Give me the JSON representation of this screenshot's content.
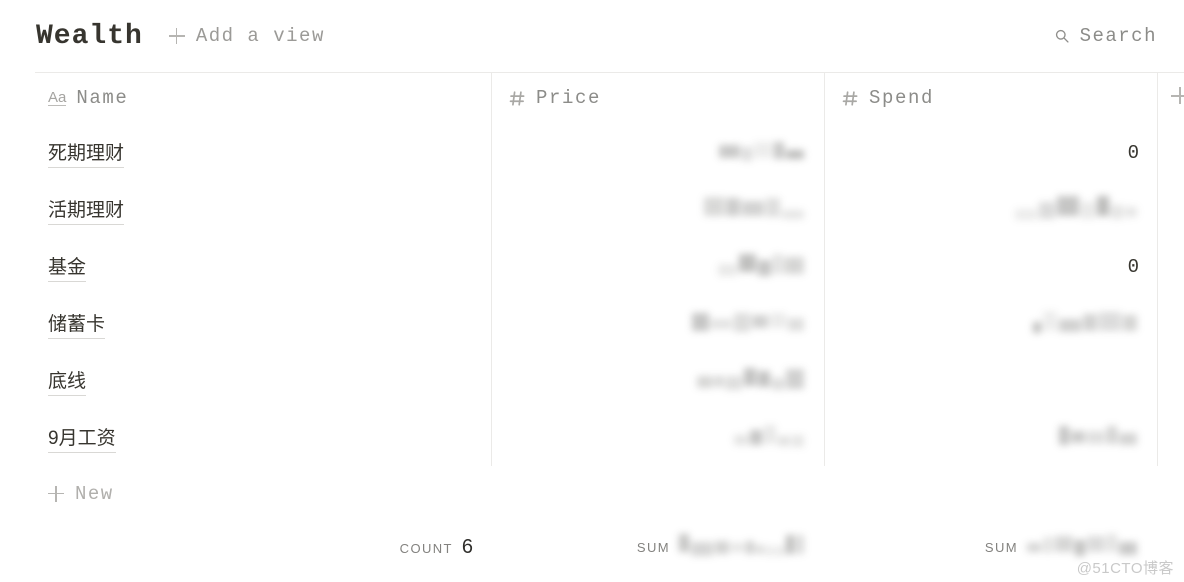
{
  "header": {
    "title": "Wealth",
    "add_view_label": "Add a view",
    "add_view_icon": "plus-icon",
    "search_label": "Search",
    "search_icon": "search-icon"
  },
  "table": {
    "columns": [
      {
        "label": "Name",
        "icon": "text-aa-icon",
        "type": "text"
      },
      {
        "label": "Price",
        "icon": "hash-icon",
        "type": "number"
      },
      {
        "label": "Spend",
        "icon": "hash-icon",
        "type": "number"
      }
    ],
    "add_column_icon": "plus-icon",
    "rows": [
      {
        "name": "死期理财",
        "price": "",
        "price_redacted": true,
        "spend": "0",
        "spend_redacted": false
      },
      {
        "name": "活期理财",
        "price": "",
        "price_redacted": true,
        "spend": "",
        "spend_redacted": true
      },
      {
        "name": "基金",
        "price": "",
        "price_redacted": true,
        "spend": "0",
        "spend_redacted": false
      },
      {
        "name": "储蓄卡",
        "price": "",
        "price_redacted": true,
        "spend": "",
        "spend_redacted": true
      },
      {
        "name": "底线",
        "price": "",
        "price_redacted": true,
        "spend": "",
        "spend_redacted": false
      },
      {
        "name": "9月工资",
        "price": "",
        "price_redacted": true,
        "spend": "",
        "spend_redacted": true
      }
    ],
    "new_row_label": "New",
    "new_row_icon": "plus-icon"
  },
  "footer": {
    "count_label": "COUNT",
    "count_value": "6",
    "price_sum_label": "SUM",
    "price_sum_value": "",
    "price_sum_redacted": true,
    "spend_sum_label": "SUM",
    "spend_sum_value": "",
    "spend_sum_redacted": true
  },
  "watermark": "@51CTO博客"
}
